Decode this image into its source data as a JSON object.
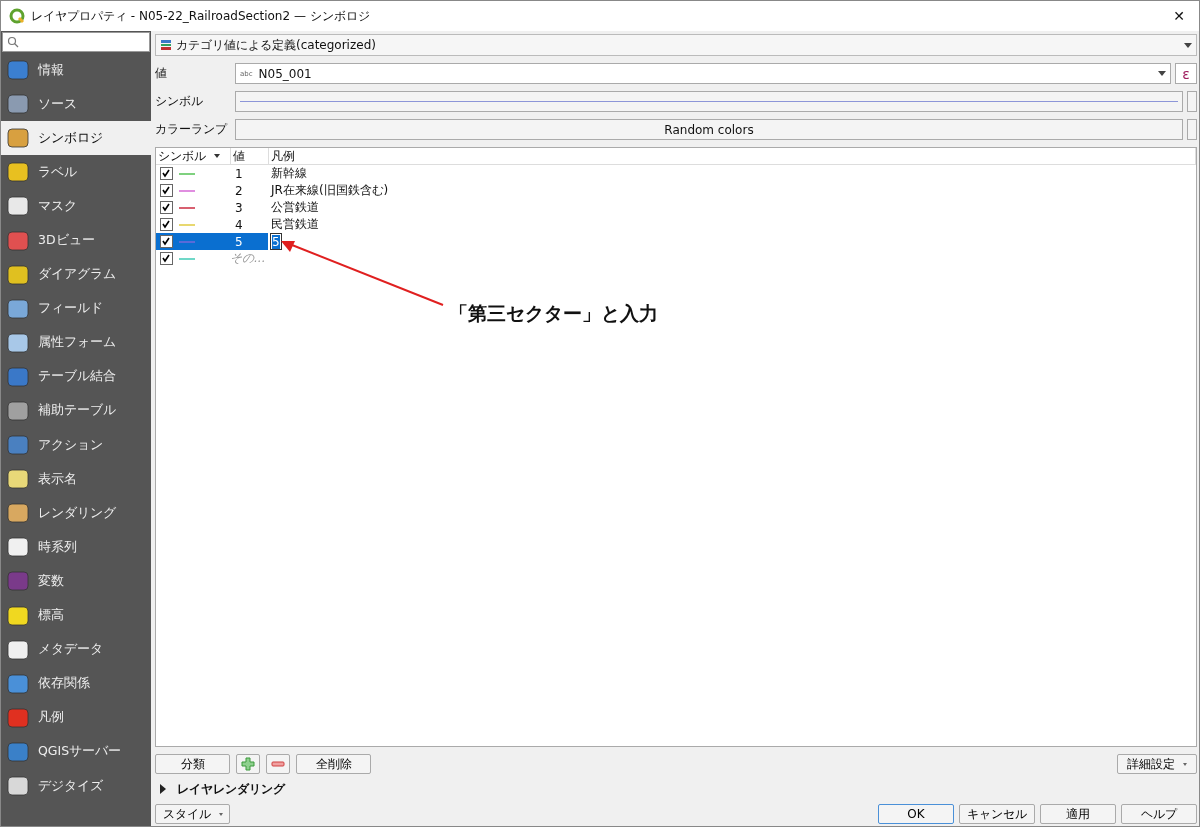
{
  "window": {
    "title": "レイヤプロパティ - N05-22_RailroadSection2 — シンボロジ",
    "close": "✕"
  },
  "sidebar": {
    "items": [
      {
        "label": "情報",
        "selected": false
      },
      {
        "label": "ソース",
        "selected": false
      },
      {
        "label": "シンボロジ",
        "selected": true
      },
      {
        "label": "ラベル",
        "selected": false
      },
      {
        "label": "マスク",
        "selected": false
      },
      {
        "label": "3Dビュー",
        "selected": false
      },
      {
        "label": "ダイアグラム",
        "selected": false
      },
      {
        "label": "フィールド",
        "selected": false
      },
      {
        "label": "属性フォーム",
        "selected": false
      },
      {
        "label": "テーブル結合",
        "selected": false
      },
      {
        "label": "補助テーブル",
        "selected": false
      },
      {
        "label": "アクション",
        "selected": false
      },
      {
        "label": "表示名",
        "selected": false
      },
      {
        "label": "レンダリング",
        "selected": false
      },
      {
        "label": "時系列",
        "selected": false
      },
      {
        "label": "変数",
        "selected": false
      },
      {
        "label": "標高",
        "selected": false
      },
      {
        "label": "メタデータ",
        "selected": false
      },
      {
        "label": "依存関係",
        "selected": false
      },
      {
        "label": "凡例",
        "selected": false
      },
      {
        "label": "QGISサーバー",
        "selected": false
      },
      {
        "label": "デジタイズ",
        "selected": false
      }
    ]
  },
  "renderer": {
    "label": "カテゴリ値による定義(categorized)"
  },
  "value": {
    "label": "値",
    "type_hint": "abc",
    "value": "N05_001",
    "expr": "ε"
  },
  "symbol": {
    "label": "シンボル"
  },
  "color_ramp": {
    "label": "カラーランプ",
    "value": "Random colors"
  },
  "table": {
    "columns": [
      "シンボル",
      "値",
      "凡例"
    ],
    "rows": [
      {
        "checked": true,
        "color": "#7fd17f",
        "value": "1",
        "legend": "新幹線",
        "selected": false,
        "editing": false,
        "kind": "category"
      },
      {
        "checked": true,
        "color": "#e08ee0",
        "value": "2",
        "legend": "JR在来線(旧国鉄含む)",
        "selected": false,
        "editing": false,
        "kind": "category"
      },
      {
        "checked": true,
        "color": "#d86070",
        "value": "3",
        "legend": "公営鉄道",
        "selected": false,
        "editing": false,
        "kind": "category"
      },
      {
        "checked": true,
        "color": "#e8d870",
        "value": "4",
        "legend": "民営鉄道",
        "selected": false,
        "editing": false,
        "kind": "category"
      },
      {
        "checked": true,
        "color": "#5a6ad8",
        "value": "5",
        "legend": "5",
        "selected": true,
        "editing": true,
        "kind": "category"
      },
      {
        "checked": true,
        "color": "#70d8c8",
        "value": "その...",
        "legend": "",
        "selected": false,
        "editing": false,
        "kind": "other"
      }
    ]
  },
  "buttons": {
    "classify": "分類",
    "delete_all": "全削除",
    "advanced": "詳細設定"
  },
  "layer_rendering": {
    "label": "レイヤレンダリング",
    "expanded": false
  },
  "style_button": "スタイル",
  "dialog_buttons": [
    "OK",
    "キャンセル",
    "適用",
    "ヘルプ"
  ],
  "annotation": {
    "text": "「第三セクター」と入力"
  }
}
